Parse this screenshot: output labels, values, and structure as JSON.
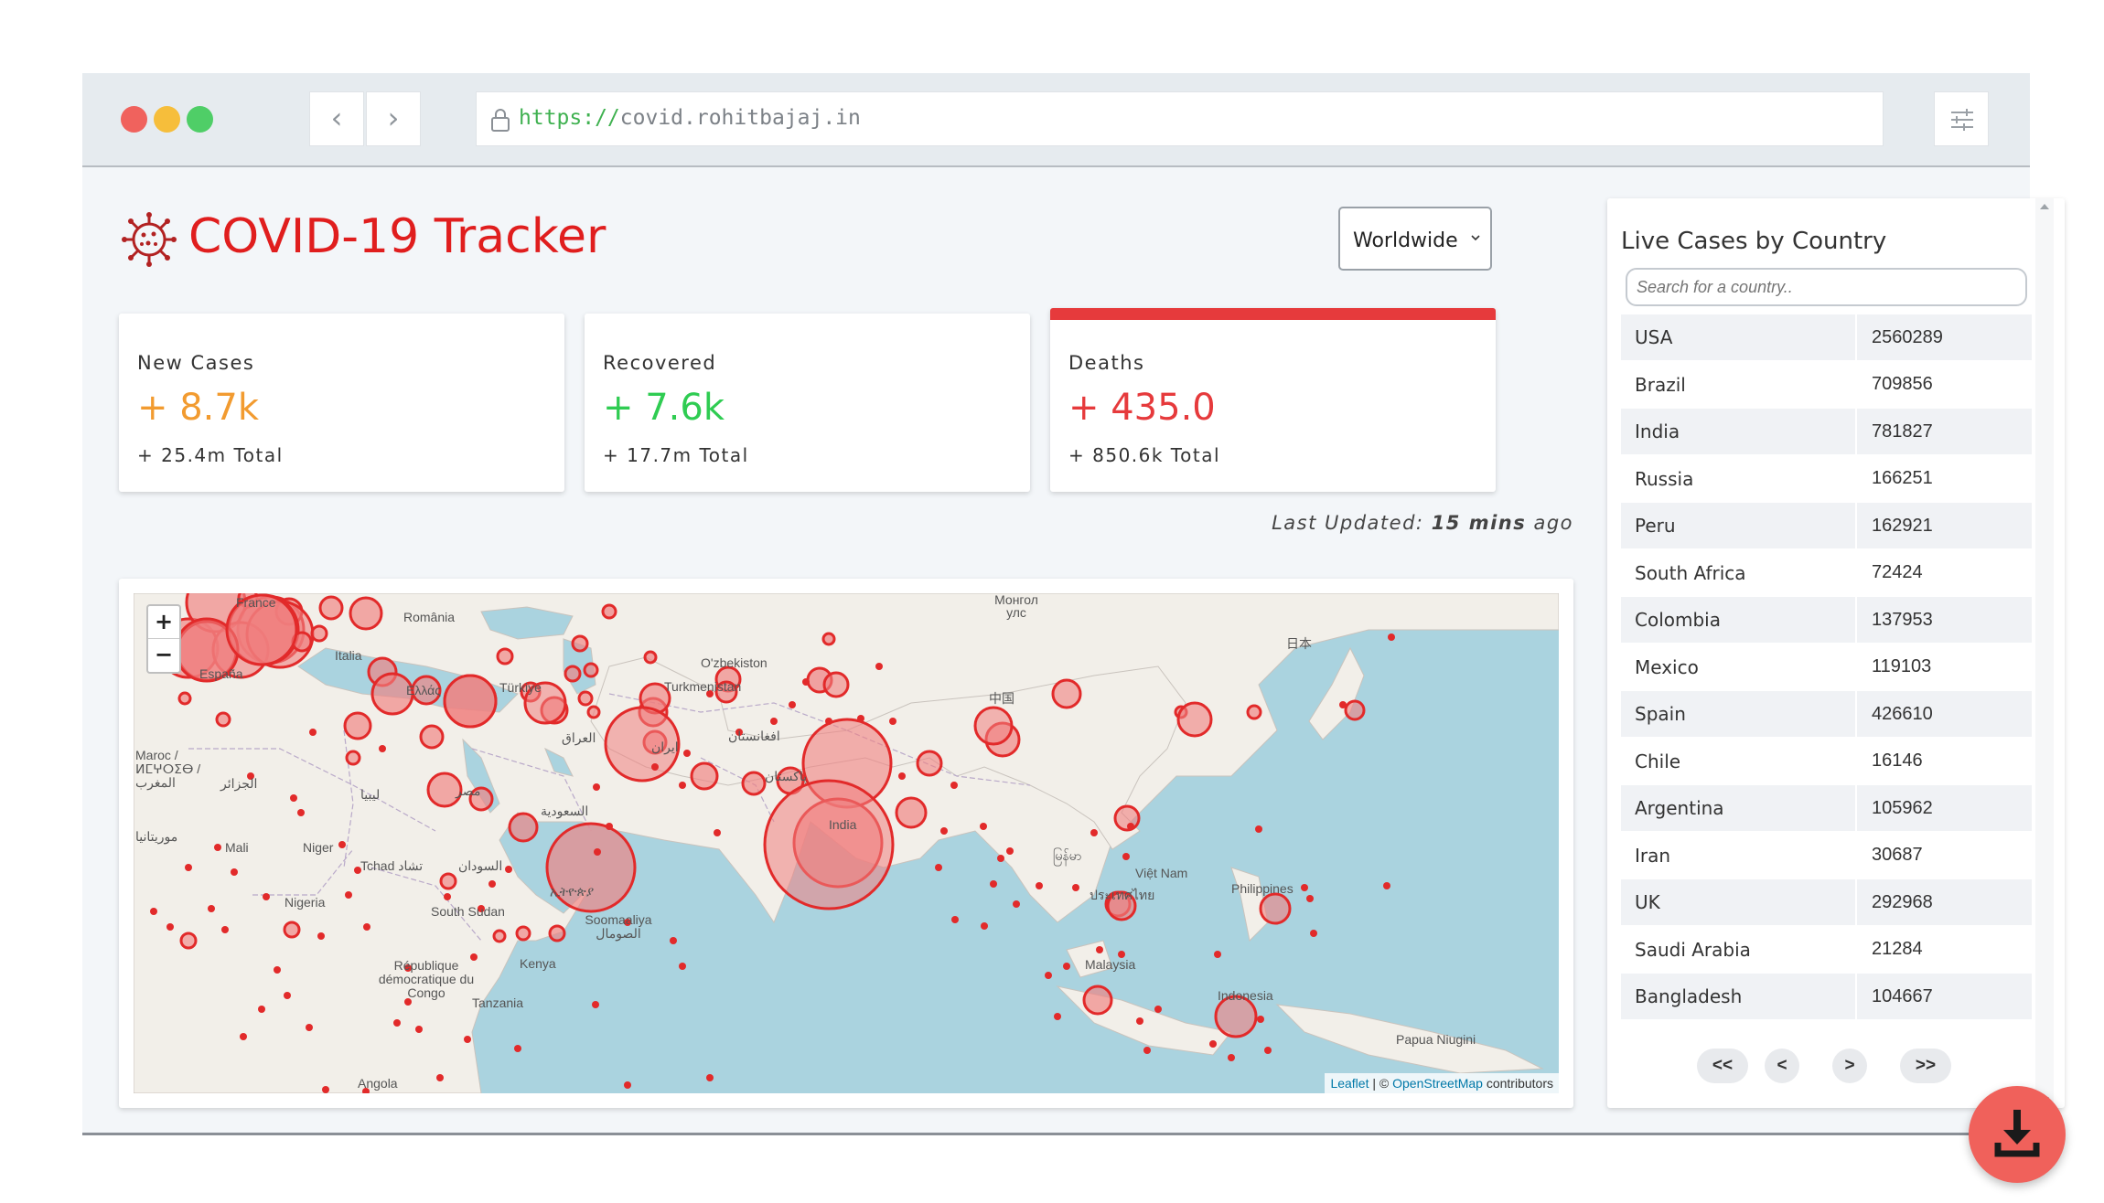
{
  "browser": {
    "url_scheme": "https://",
    "url_host": "covid.rohitbajaj.in",
    "back_label": "‹",
    "forward_label": "›"
  },
  "header": {
    "title": "COVID-19 Tracker",
    "region_selected": "Worldwide"
  },
  "stats": [
    {
      "label": "New Cases",
      "value": "+ 8.7k",
      "total": "+ 25.4m Total",
      "color": "#f29b30"
    },
    {
      "label": "Recovered",
      "value": "+ 7.6k",
      "total": "+ 17.7m Total",
      "color": "#2fcc52"
    },
    {
      "label": "Deaths",
      "value": "+ 435.0",
      "total": "+ 850.6k Total",
      "color": "#e63a3c",
      "active": true
    }
  ],
  "last_updated": {
    "prefix": "Last Updated:",
    "value": "15 mins",
    "suffix": "ago"
  },
  "map": {
    "zoom_in": "+",
    "zoom_out": "−",
    "attribution_leaflet": "Leaflet",
    "attribution_sep": " | © ",
    "attribution_osm": "OpenStreetMap",
    "attribution_tail": " contributors",
    "labels": {
      "france": "France",
      "espana": "España",
      "italia": "Italia",
      "romania": "România",
      "ellas": "Ελλάς",
      "turkiye": "Türkiye",
      "iraq": "العراق",
      "iran": "ایران",
      "turkmenistan": "Turkmenistan",
      "uzbekiston": "O'zbekiston",
      "afghanistan": "افغانستان",
      "pakistan": "پاکستان",
      "china": "中国",
      "mongolia": "Монгол улс",
      "japan": "日本",
      "india": "India",
      "maroc": "Maroc / ⵍⵎⵖⵔⵉⴱ / المغرب",
      "algeria": "الجزائر",
      "libya": "ليبيا",
      "egypt": "مصر",
      "saudi": "السعودية",
      "mauritania": "موريتانيا",
      "mali": "Mali",
      "niger": "Niger",
      "tchad": "Tchad تشاد",
      "sudan": "السودان",
      "nigeria": "Nigeria",
      "southsudan": "South Sudan",
      "ethiopia": "ኢትዮጵያ",
      "somalia": "Soomaaliya الصومال",
      "kenya": "Kenya",
      "rdc": "République démocratique du Congo",
      "tanzania": "Tanzania",
      "angola": "Angola",
      "myanmar": "မြန်မာ",
      "thailand": "ประเทศไทย",
      "vietnam": "Việt Nam",
      "philippines": "Philippines",
      "malaysia": "Malaysia",
      "indonesia": "Indonesia",
      "papua": "Papua Niugini"
    }
  },
  "sidebar": {
    "title": "Live Cases by Country",
    "search_placeholder": "Search for a country..",
    "rows": [
      {
        "country": "USA",
        "cases": "2560289"
      },
      {
        "country": "Brazil",
        "cases": "709856"
      },
      {
        "country": "India",
        "cases": "781827"
      },
      {
        "country": "Russia",
        "cases": "166251"
      },
      {
        "country": "Peru",
        "cases": "162921"
      },
      {
        "country": "South Africa",
        "cases": "72424"
      },
      {
        "country": "Colombia",
        "cases": "137953"
      },
      {
        "country": "Mexico",
        "cases": "119103"
      },
      {
        "country": "Spain",
        "cases": "426610"
      },
      {
        "country": "Chile",
        "cases": "16146"
      },
      {
        "country": "Argentina",
        "cases": "105962"
      },
      {
        "country": "Iran",
        "cases": "30687"
      },
      {
        "country": "UK",
        "cases": "292968"
      },
      {
        "country": "Saudi Arabia",
        "cases": "21284"
      },
      {
        "country": "Bangladesh",
        "cases": "104667"
      }
    ],
    "pager": {
      "first": "<<",
      "prev": "<",
      "next": ">",
      "last": ">>"
    }
  },
  "icons": {
    "logo": "virus-icon",
    "lock": "lock-icon",
    "settings": "sliders-icon",
    "download": "download-icon"
  },
  "colors": {
    "brand_red": "#e01e1e",
    "bubble_fill": "#f08080",
    "bubble_stroke": "#e22a2a",
    "fab": "#f0615b"
  }
}
